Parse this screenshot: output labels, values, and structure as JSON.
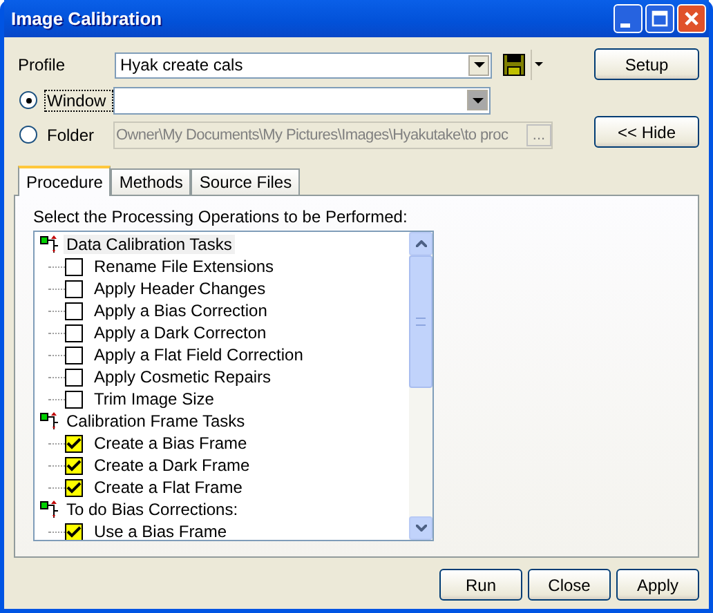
{
  "window": {
    "title": "Image Calibration"
  },
  "profile": {
    "label": "Profile",
    "value": "Hyak create cals"
  },
  "sources": [
    {
      "label": "Window",
      "selected": true,
      "kind": "combo"
    },
    {
      "label": "Folder",
      "selected": false,
      "kind": "path",
      "value": "Owner\\My Documents\\My Pictures\\Images\\Hyakutake\\to proc",
      "browse": "..."
    }
  ],
  "side_buttons": [
    "Setup",
    "<< Hide"
  ],
  "tabs": [
    {
      "label": "Procedure",
      "selected": true
    },
    {
      "label": "Methods",
      "selected": false
    },
    {
      "label": "Source Files",
      "selected": false
    }
  ],
  "instruction": "Select the Processing Operations to be Performed:",
  "tree": [
    {
      "label": "Data Calibration Tasks",
      "selected": true,
      "children": [
        {
          "label": "Rename File Extensions",
          "checked": false
        },
        {
          "label": "Apply Header Changes",
          "checked": false
        },
        {
          "label": "Apply a Bias Correction",
          "checked": false
        },
        {
          "label": "Apply a Dark Correcton",
          "checked": false
        },
        {
          "label": "Apply a Flat Field Correction",
          "checked": false
        },
        {
          "label": "Apply Cosmetic Repairs",
          "checked": false
        },
        {
          "label": "Trim Image Size",
          "checked": false
        }
      ]
    },
    {
      "label": "Calibration Frame Tasks",
      "selected": false,
      "children": [
        {
          "label": "Create a Bias Frame",
          "checked": true
        },
        {
          "label": "Create a Dark Frame",
          "checked": true
        },
        {
          "label": "Create a Flat Frame",
          "checked": true
        }
      ]
    },
    {
      "label": "To do Bias Corrections:",
      "selected": false,
      "children": [
        {
          "label": "Use a Bias Frame",
          "checked": true
        }
      ]
    }
  ],
  "buttons": [
    "Run",
    "Close",
    "Apply"
  ]
}
